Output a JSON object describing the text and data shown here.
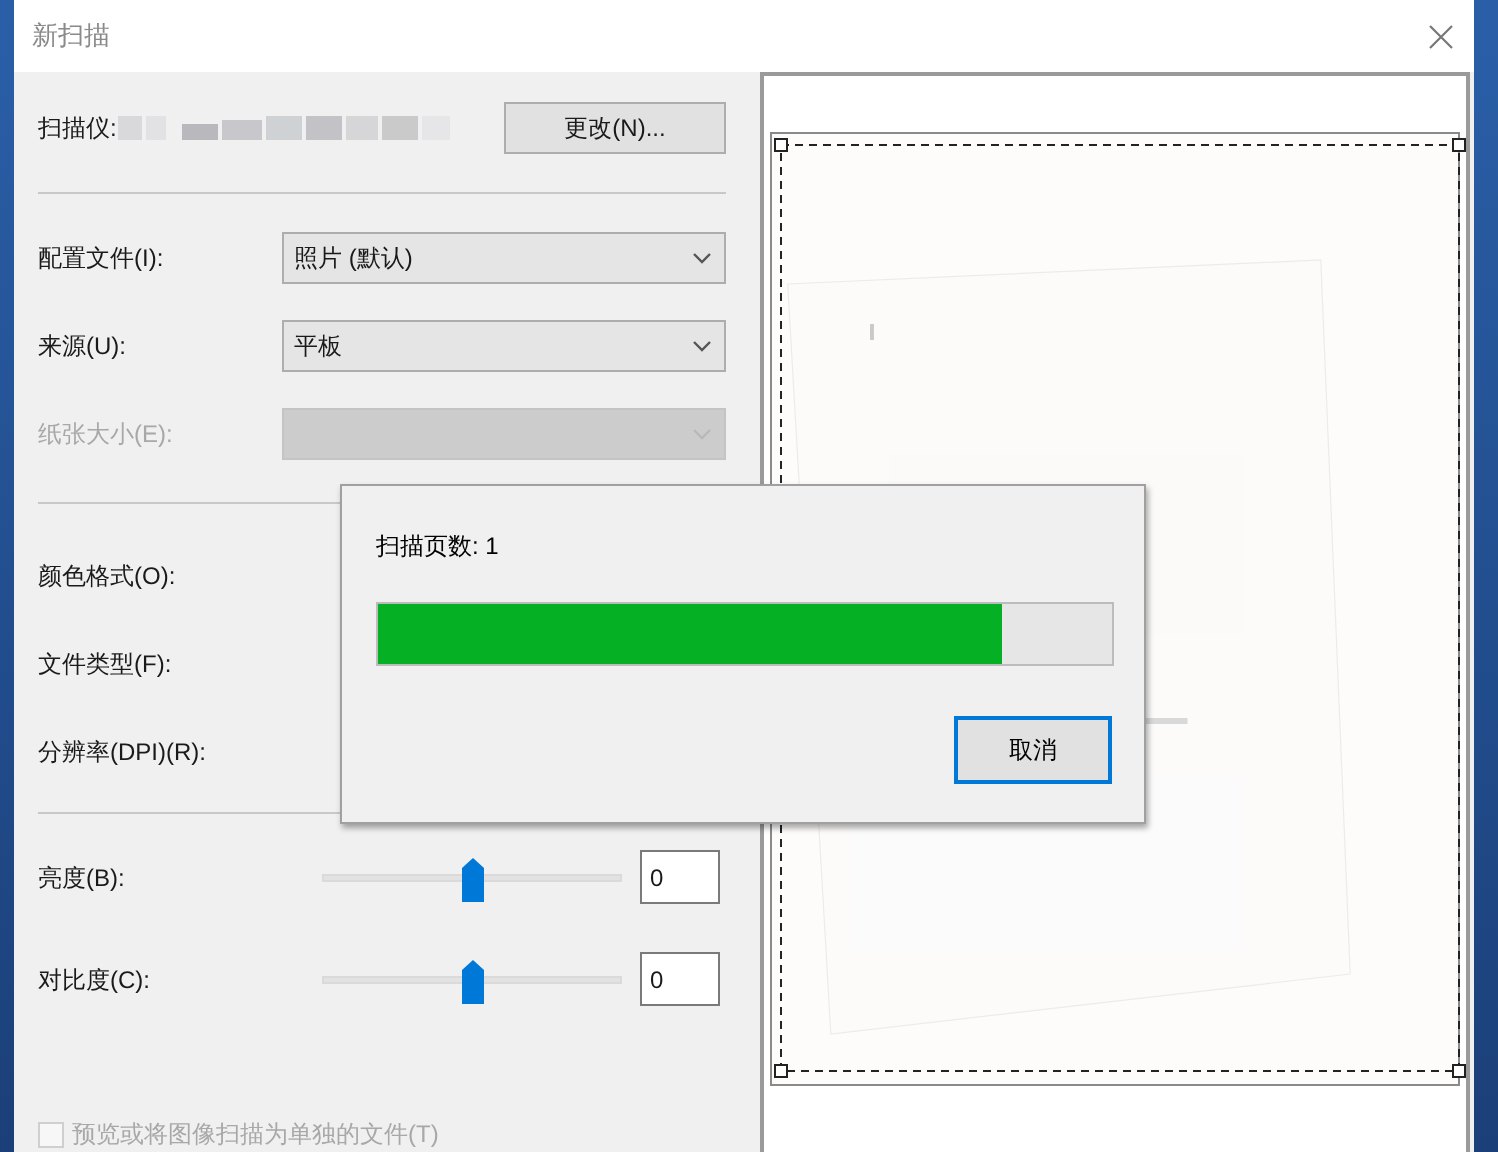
{
  "window": {
    "title": "新扫描"
  },
  "scanner": {
    "label": "扫描仪:",
    "button": "更改(N)..."
  },
  "dropdowns": [
    {
      "label": "配置文件(I):",
      "value": "照片 (默认)",
      "disabled": false
    },
    {
      "label": "来源(U):",
      "value": "平板",
      "disabled": false
    },
    {
      "label": "纸张大小(E):",
      "disabled": true
    }
  ],
  "hidden_fields": [
    {
      "label": "颜色格式(O):"
    },
    {
      "label": "文件类型(F):"
    },
    {
      "label": "分辨率(DPI)(R):"
    }
  ],
  "sliders": [
    {
      "label": "亮度(B):",
      "level": 0.5,
      "value": "0"
    },
    {
      "label": "对比度(C):",
      "level": 0.5,
      "value": "0"
    }
  ],
  "checkbox": {
    "label": "预览或将图像扫描为单独的文件(T)",
    "checked": false,
    "disabled": true
  },
  "progress_dialog": {
    "text": "扫描页数: 1",
    "level": 0.85,
    "button": "取消"
  }
}
